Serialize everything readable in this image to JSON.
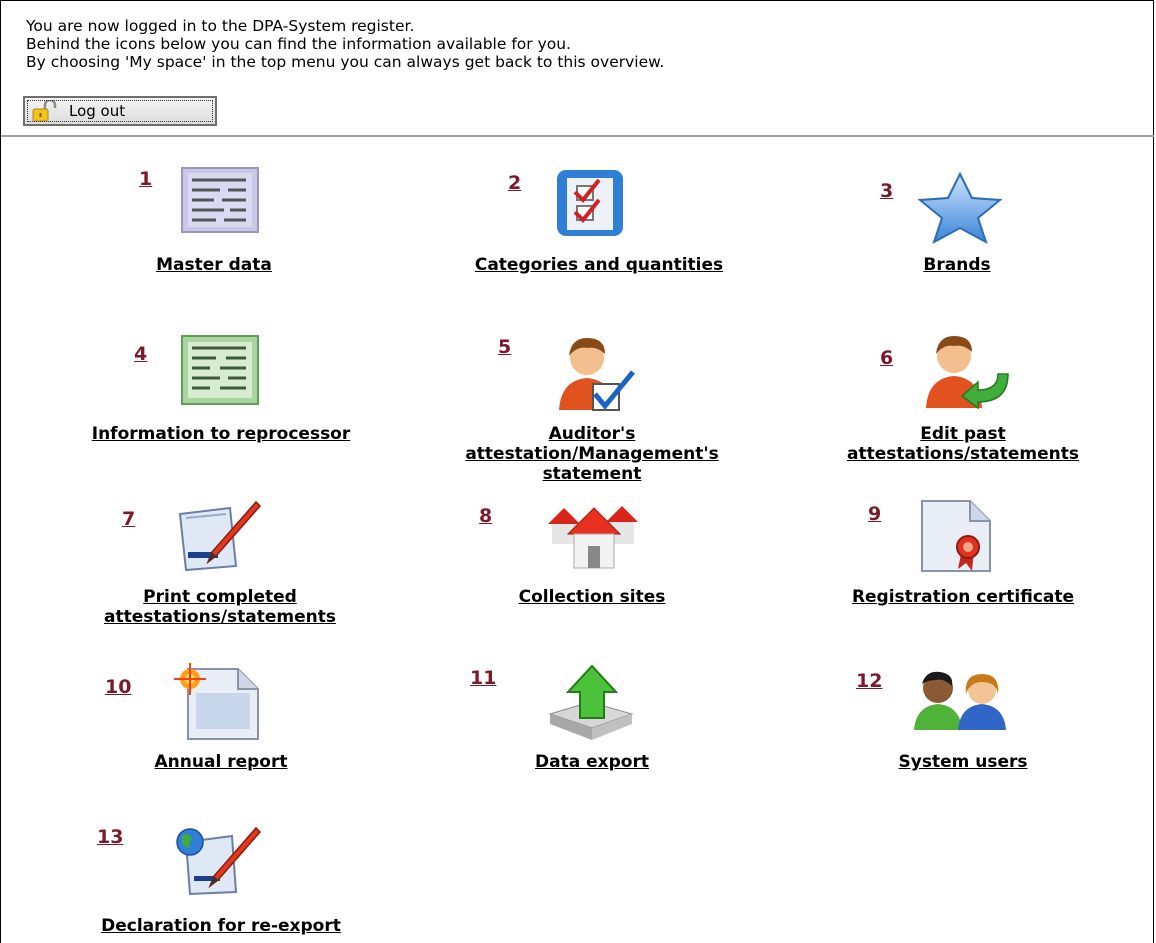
{
  "intro": {
    "line1": "You are now logged in to the DPA-System register.",
    "line2": "Behind the icons below you can find the information available for you.",
    "line3": "By choosing 'My space' in the top menu you can always get back to this overview."
  },
  "logout": {
    "label": "Log out",
    "icon": "lock-icon"
  },
  "tiles": [
    {
      "number": "1",
      "label": "Master data",
      "icon": "document-list-icon"
    },
    {
      "number": "2",
      "label": "Categories and quantities",
      "icon": "checklist-icon"
    },
    {
      "number": "3",
      "label": "Brands",
      "icon": "star-icon"
    },
    {
      "number": "4",
      "label": "Information to reprocessor",
      "icon": "green-document-icon"
    },
    {
      "number": "5",
      "label_line1": "Auditor's",
      "label_line2": "attestation/Management's",
      "label_line3": "statement",
      "icon": "user-check-icon"
    },
    {
      "number": "6",
      "label_line1": "Edit past",
      "label_line2": "attestations/statements",
      "icon": "user-arrow-icon"
    },
    {
      "number": "7",
      "label_line1": "Print completed",
      "label_line2": "attestations/statements",
      "icon": "pen-document-icon"
    },
    {
      "number": "8",
      "label": "Collection sites",
      "icon": "houses-icon"
    },
    {
      "number": "9",
      "label": "Registration certificate",
      "icon": "certificate-icon"
    },
    {
      "number": "10",
      "label": "Annual report",
      "icon": "new-document-icon"
    },
    {
      "number": "11",
      "label": "Data export",
      "icon": "export-arrow-icon"
    },
    {
      "number": "12",
      "label": "System users",
      "icon": "users-icon"
    },
    {
      "number": "13",
      "label": "Declaration for re-export",
      "icon": "globe-pen-icon"
    }
  ]
}
